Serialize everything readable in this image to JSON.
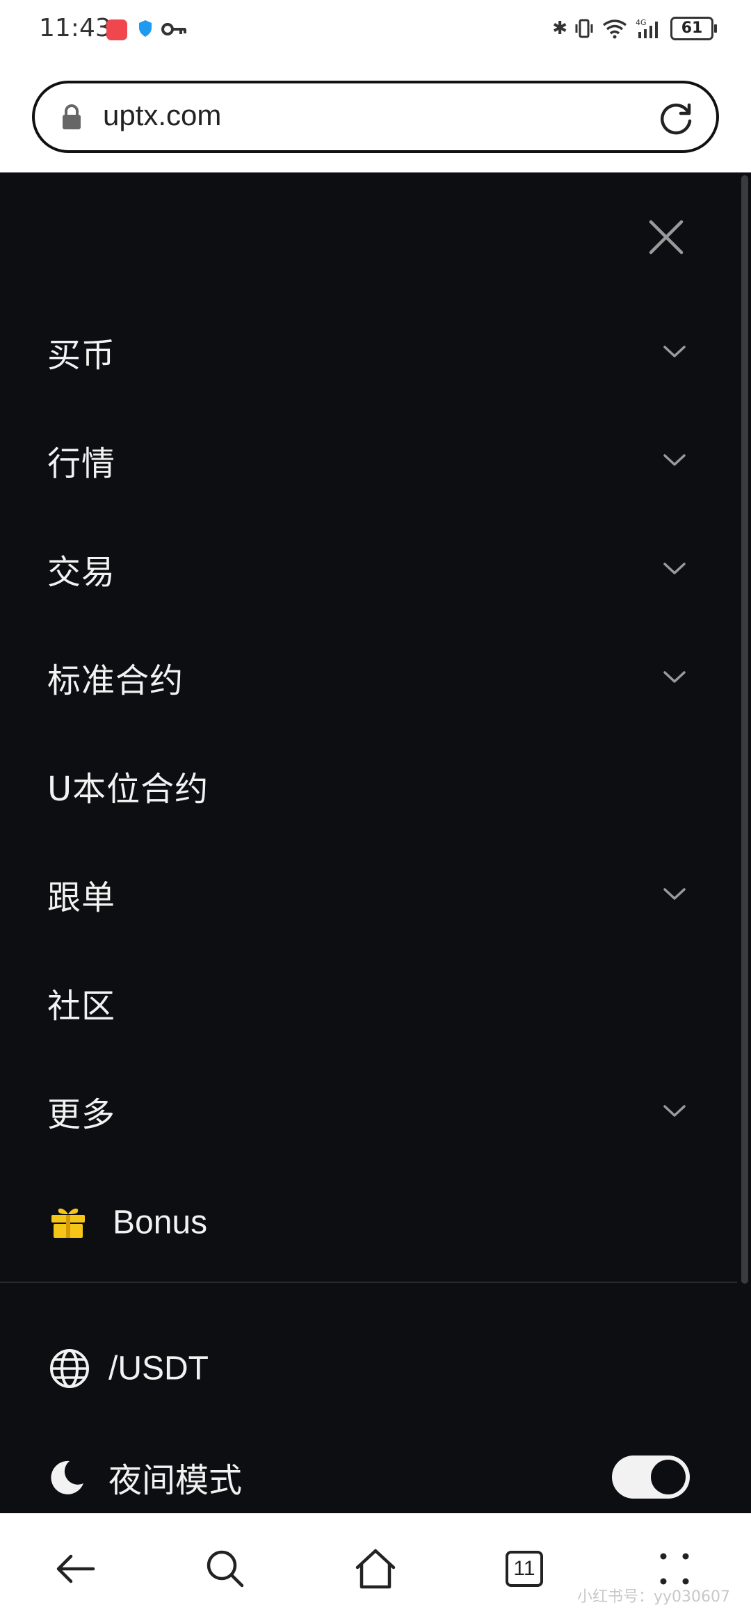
{
  "status_bar": {
    "time": "11:43",
    "battery": "61",
    "network": "4G",
    "wifi_badge": "6"
  },
  "browser": {
    "url": "uptx.com"
  },
  "menu": {
    "items": [
      {
        "label": "买币",
        "has_chevron": true
      },
      {
        "label": "行情",
        "has_chevron": true
      },
      {
        "label": "交易",
        "has_chevron": true
      },
      {
        "label": "标准合约",
        "has_chevron": true
      },
      {
        "label": "U本位合约",
        "has_chevron": false
      },
      {
        "label": "跟单",
        "has_chevron": true
      },
      {
        "label": "社区",
        "has_chevron": false
      },
      {
        "label": "更多",
        "has_chevron": true
      }
    ],
    "bonus_label": "Bonus",
    "currency_label": "/USDT",
    "night_mode_label": "夜间模式",
    "night_mode_on": true
  },
  "bottom_nav": {
    "tab_count": "11"
  },
  "watermark": "小红书号：yy030607",
  "colors": {
    "menu_bg": "#0d0e11",
    "text": "#f2f2f2",
    "bonus_gift": "#f5c518"
  }
}
